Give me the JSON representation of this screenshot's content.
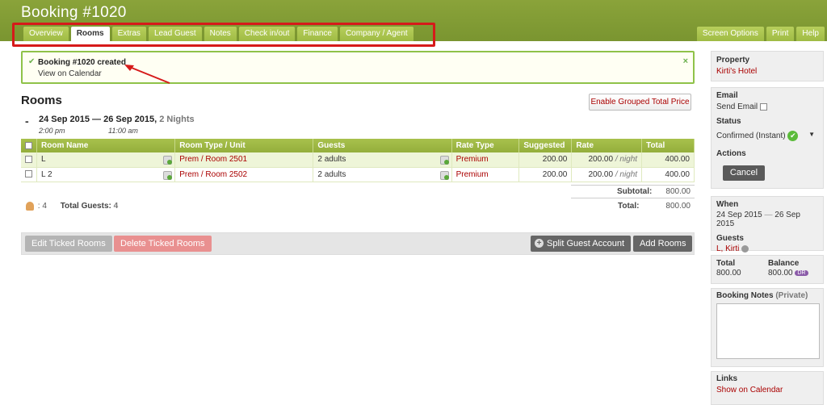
{
  "header": {
    "title": "Booking #1020",
    "tabs": [
      "Overview",
      "Rooms",
      "Extras",
      "Lead Guest",
      "Notes",
      "Check in/out",
      "Finance",
      "Company / Agent"
    ],
    "right_tabs": [
      "Screen Options",
      "Print",
      "Help"
    ]
  },
  "notice": {
    "message": "Booking #1020 created",
    "link": "View on Calendar",
    "close": "×"
  },
  "rooms": {
    "title": "Rooms",
    "grouped_button": "Enable Grouped Total Price",
    "dash": "-",
    "date_range": "24 Sep 2015  —  26 Sep 2015,",
    "nights": "2 Nights",
    "checkin_time": "2:00 pm",
    "checkout_time": "11:00 am",
    "columns": [
      "Room Name",
      "Room Type / Unit",
      "Guests",
      "Rate Type",
      "Suggested",
      "Rate",
      "Total"
    ],
    "rows": [
      {
        "name": "L",
        "type_unit": "Prem / Room 2501",
        "guests": "2 adults",
        "rate_type": "Premium",
        "suggested": "200.00",
        "rate": "200.00",
        "per": "/ night",
        "total": "400.00"
      },
      {
        "name": "L 2",
        "type_unit": "Prem / Room 2502",
        "guests": "2 adults",
        "rate_type": "Premium",
        "suggested": "200.00",
        "rate": "200.00",
        "per": "/ night",
        "total": "400.00"
      }
    ],
    "subtotal_label": "Subtotal:",
    "subtotal_value": "800.00",
    "total_label": "Total:",
    "total_value": "800.00",
    "guest_icon_count": ": 4",
    "total_guests_label": "Total Guests:",
    "total_guests_value": "4"
  },
  "actions": {
    "edit": "Edit Ticked Rooms",
    "delete": "Delete Ticked Rooms",
    "split": "Split Guest Account",
    "add": "Add Rooms"
  },
  "sidebar": {
    "property_label": "Property",
    "property_value": "Kirti's Hotel",
    "email_label": "Email",
    "send_email": "Send Email",
    "status_label": "Status",
    "status_value": "Confirmed (Instant)",
    "actions_label": "Actions",
    "cancel": "Cancel",
    "when_label": "When",
    "when_from": "24 Sep 2015",
    "when_sep": "—",
    "when_to": "26 Sep 2015",
    "guests_label": "Guests",
    "guest_name": "L, Kirti",
    "total_label": "Total",
    "total_value": "800.00",
    "balance_label": "Balance",
    "balance_value": "800.00",
    "balance_badge": "DR",
    "notes_label": "Booking Notes",
    "notes_private": "(Private)",
    "links_label": "Links",
    "links_value": "Show on Calendar"
  },
  "colors": {
    "header_green": "#7a9530",
    "tab_green": "#a8c14c",
    "link_red": "#aa0000",
    "highlight_red": "#d61a1a"
  }
}
